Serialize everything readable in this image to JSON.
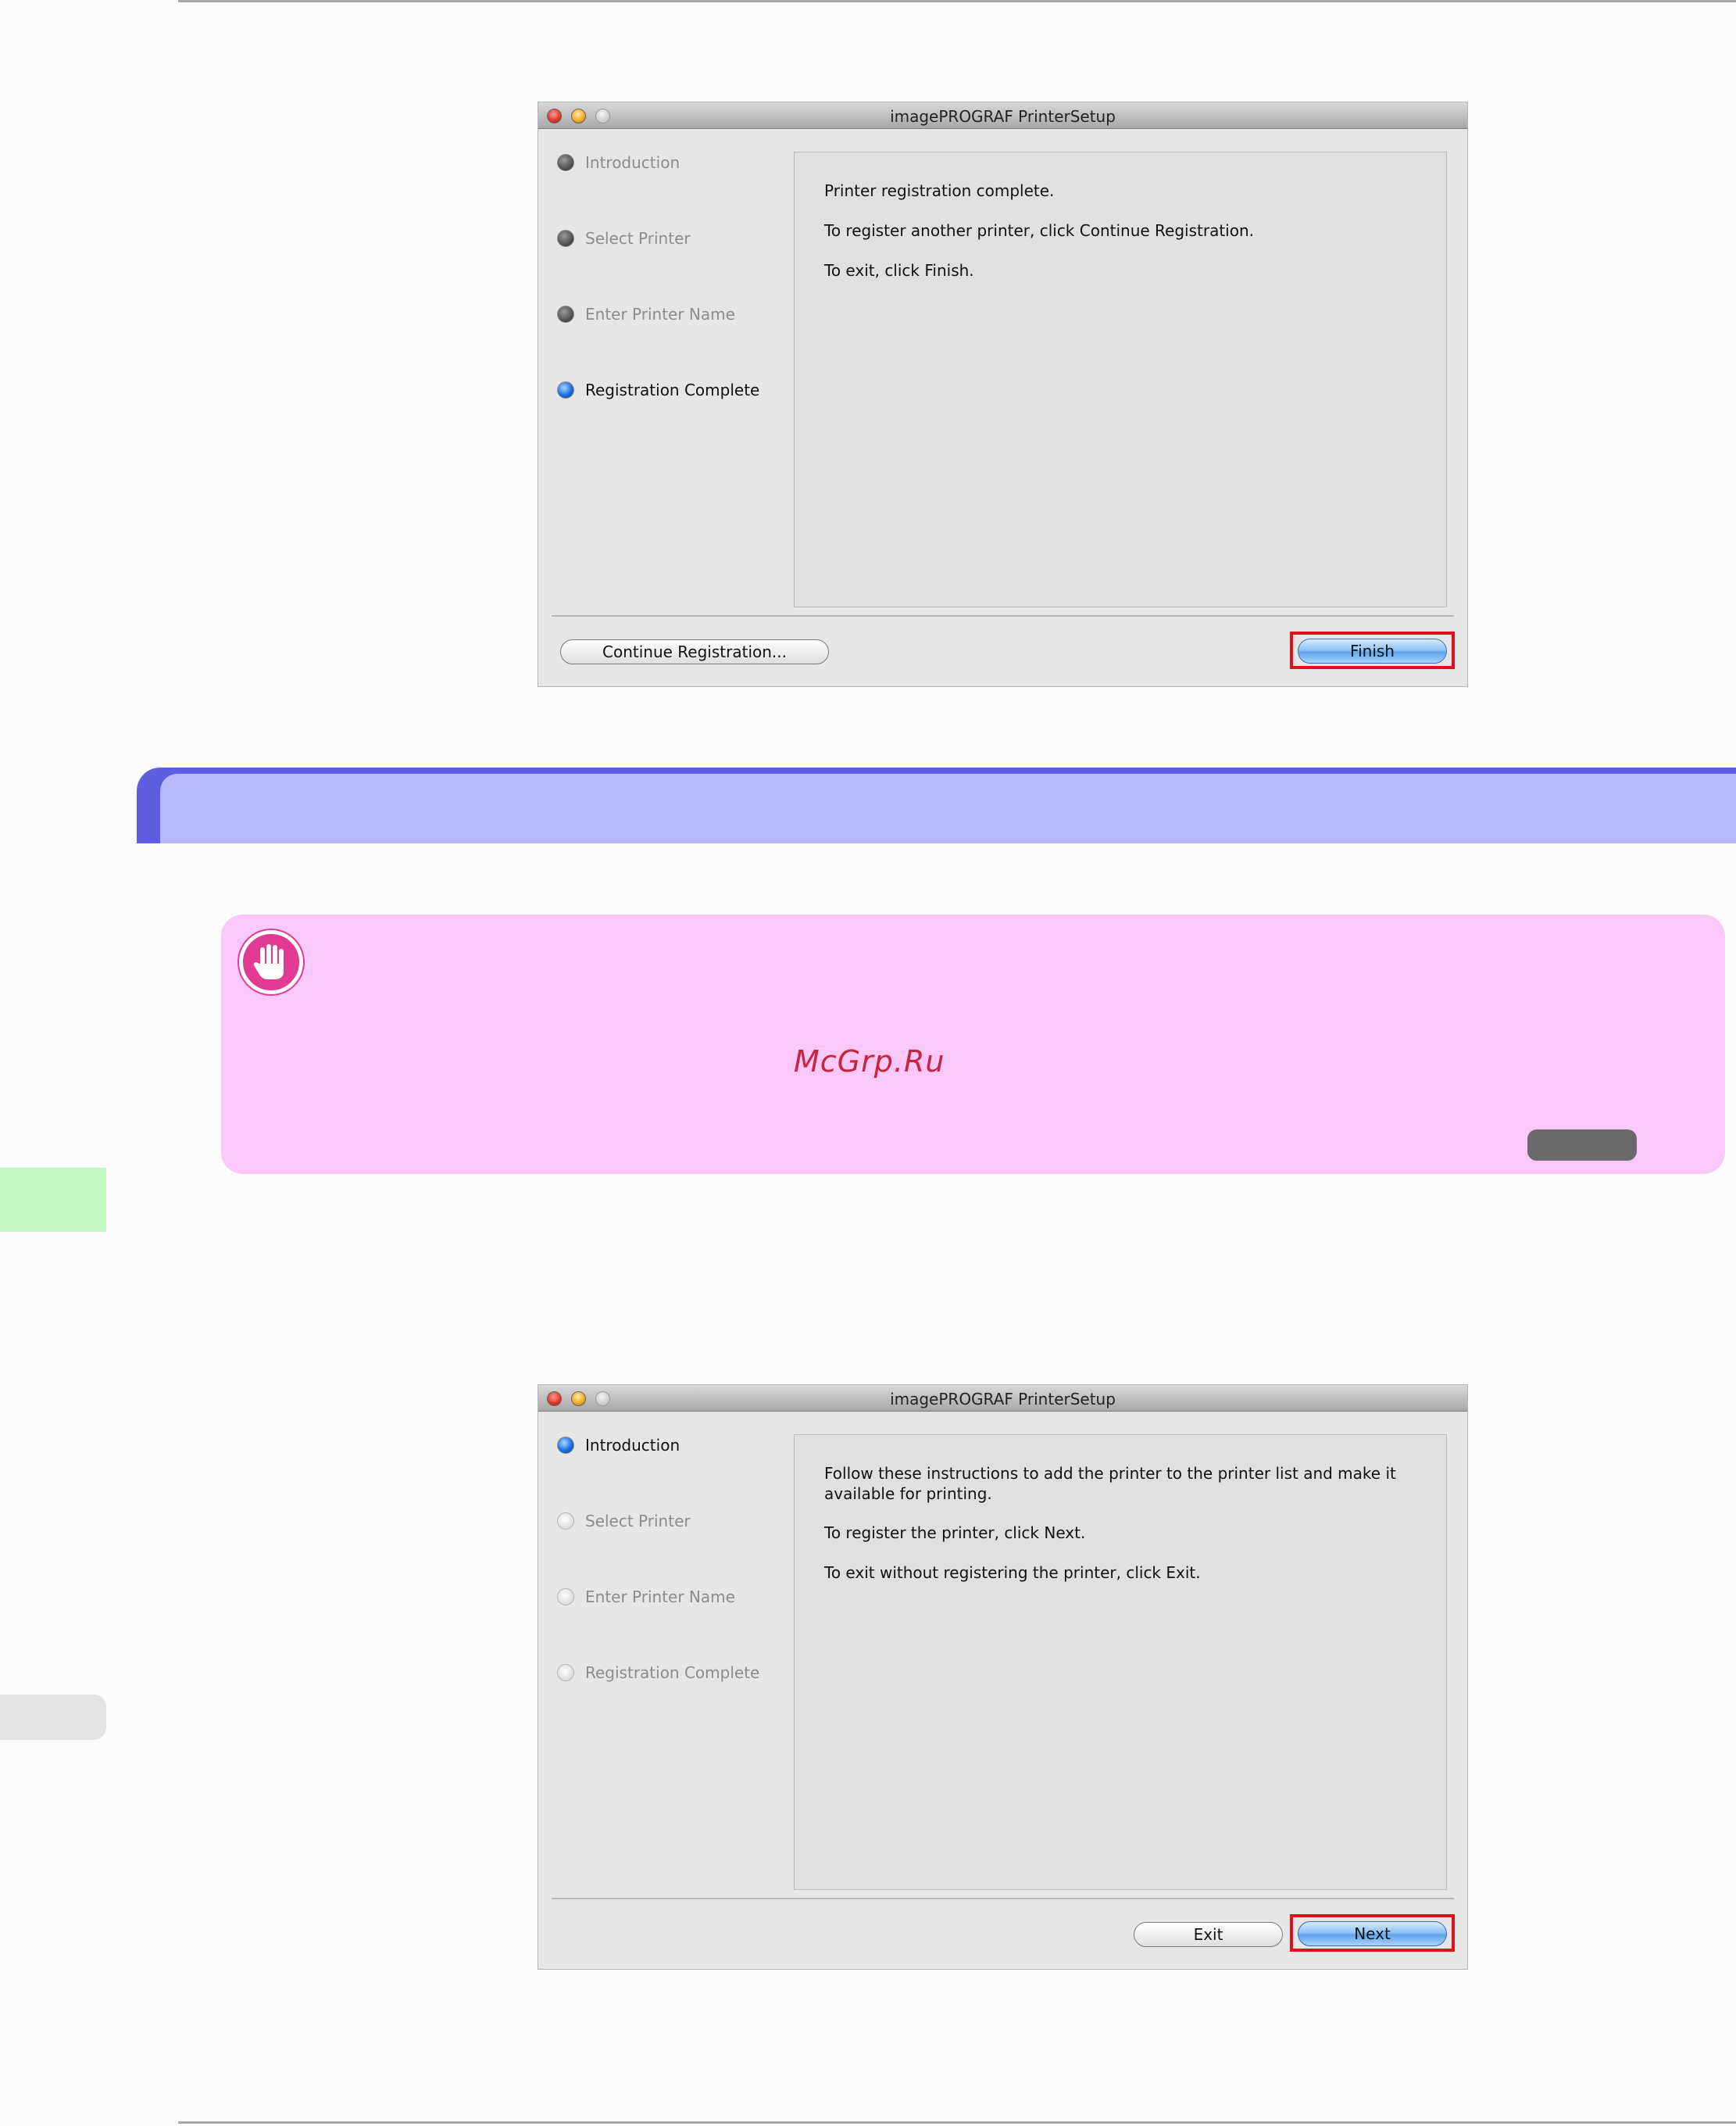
{
  "window1": {
    "title": "imagePROGRAF PrinterSetup",
    "steps": [
      "Introduction",
      "Select Printer",
      "Enter Printer Name",
      "Registration Complete"
    ],
    "lines": [
      "Printer registration complete.",
      "To register another printer, click Continue Registration.",
      "To exit, click Finish."
    ],
    "continue_label": "Continue Registration...",
    "finish_label": "Finish"
  },
  "window2": {
    "title": "imagePROGRAF PrinterSetup",
    "steps": [
      "Introduction",
      "Select Printer",
      "Enter Printer Name",
      "Registration Complete"
    ],
    "lines": [
      "Follow these instructions to add the printer to the printer list and make it available for printing.",
      "To register the printer, click Next.",
      "To exit without registering the printer, click Exit."
    ],
    "exit_label": "Exit",
    "next_label": "Next"
  },
  "note": {
    "watermark": "McGrp.Ru",
    "icon": "stop-hand-icon"
  },
  "colors": {
    "section_band": "#5d5ee0",
    "section_inner": "#b7b8fc",
    "note_bg": "#fcc8fc",
    "highlight": "#e3101c"
  }
}
